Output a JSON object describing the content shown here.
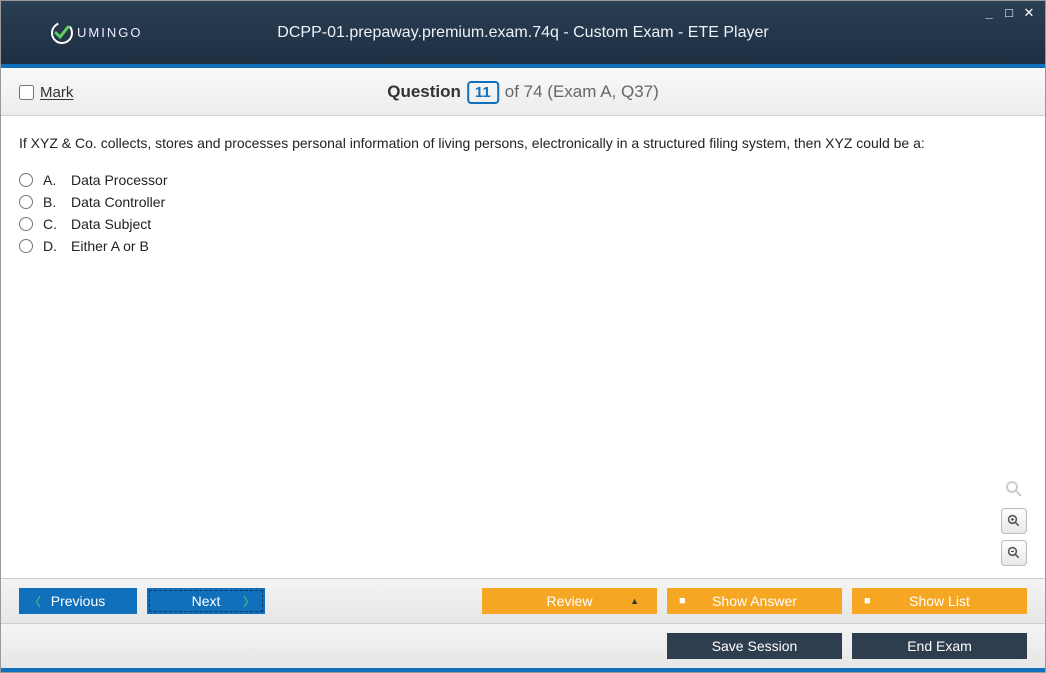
{
  "window": {
    "title": "DCPP-01.prepaway.premium.exam.74q - Custom Exam - ETE Player",
    "logo_text": "UMINGO"
  },
  "header": {
    "mark_label": "Mark",
    "question_label": "Question",
    "current_number": "11",
    "of_text": "of 74 (Exam A, Q37)"
  },
  "question": {
    "text": "If XYZ & Co. collects, stores and processes personal information of living persons, electronically in a structured filing system, then XYZ could be a:",
    "options": [
      {
        "letter": "A.",
        "text": "Data Processor"
      },
      {
        "letter": "B.",
        "text": "Data Controller"
      },
      {
        "letter": "C.",
        "text": "Data Subject"
      },
      {
        "letter": "D.",
        "text": "Either A or B"
      }
    ]
  },
  "buttons": {
    "previous": "Previous",
    "next": "Next",
    "review": "Review",
    "show_answer": "Show Answer",
    "show_list": "Show List",
    "save_session": "Save Session",
    "end_exam": "End Exam"
  }
}
